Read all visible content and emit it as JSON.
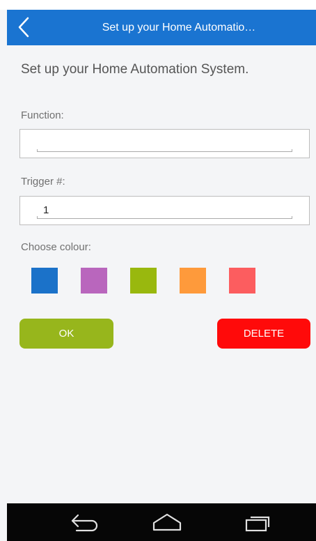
{
  "appbar": {
    "title": "Set up your Home Automatio…"
  },
  "main": {
    "heading": "Set up your Home Automation System.",
    "function_label": "Function:",
    "function_value": "",
    "trigger_label": "Trigger #:",
    "trigger_value": "1",
    "colour_label": "Choose colour:",
    "colours": [
      "#1b72c9",
      "#b966bd",
      "#99b80e",
      "#fe9a3b",
      "#fc5d5f"
    ],
    "ok_label": "OK",
    "delete_label": "DELETE",
    "ok_color": "#97b61c",
    "delete_color": "#ff0a0a"
  },
  "navbar": {
    "icons": [
      "back-icon",
      "home-icon",
      "recents-icon"
    ]
  }
}
